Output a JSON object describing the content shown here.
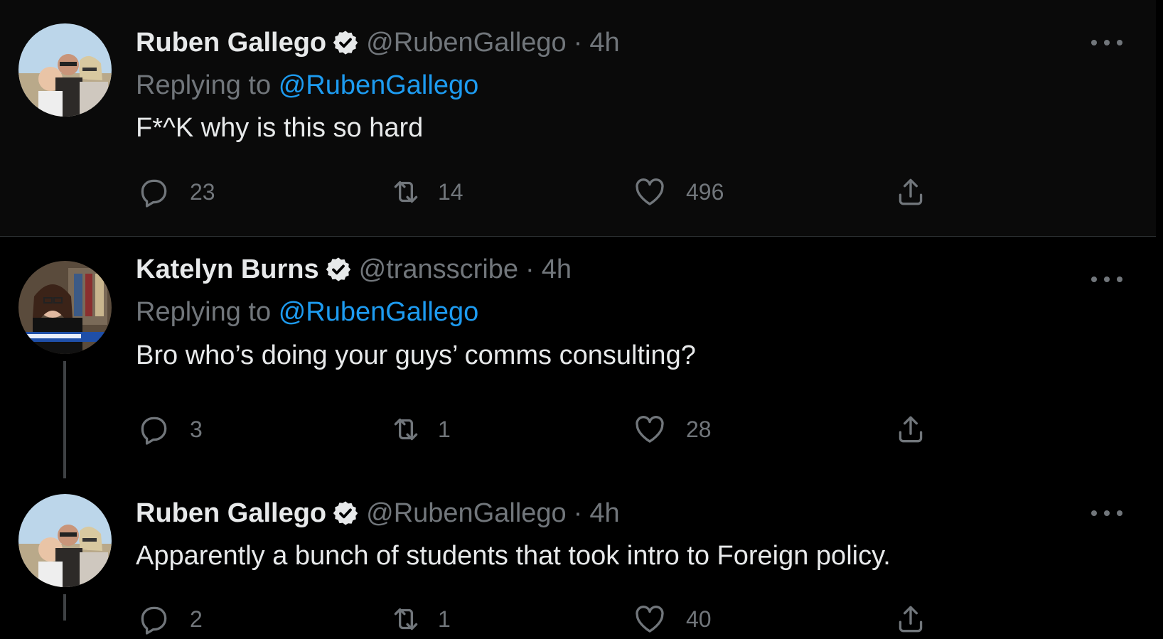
{
  "tweets": [
    {
      "name": "Ruben Gallego",
      "handle": "@RubenGallego",
      "separator": "·",
      "time": "4h",
      "replying_prefix": "Replying to",
      "replying_to": "@RubenGallego",
      "text": "F*^K why is this so hard",
      "replies": "23",
      "retweets": "14",
      "likes": "496"
    },
    {
      "name": "Katelyn Burns",
      "handle": "@transscribe",
      "separator": "·",
      "time": "4h",
      "replying_prefix": "Replying to",
      "replying_to": "@RubenGallego",
      "text": "Bro who’s doing your guys’ comms consulting?",
      "replies": "3",
      "retweets": "1",
      "likes": "28"
    },
    {
      "name": "Ruben Gallego",
      "handle": "@RubenGallego",
      "separator": "·",
      "time": "4h",
      "text": "Apparently a bunch of students that took intro to Foreign policy.",
      "replies": "2",
      "retweets": "1",
      "likes": "40"
    }
  ],
  "icons": {
    "verified": "verified-badge-icon",
    "reply": "reply-icon",
    "retweet": "retweet-icon",
    "like": "heart-icon",
    "share": "share-icon",
    "more": "more-icon"
  },
  "colors": {
    "background": "#000000",
    "text": "#e7e9ea",
    "muted": "#71767b",
    "link": "#1d9bf0"
  }
}
